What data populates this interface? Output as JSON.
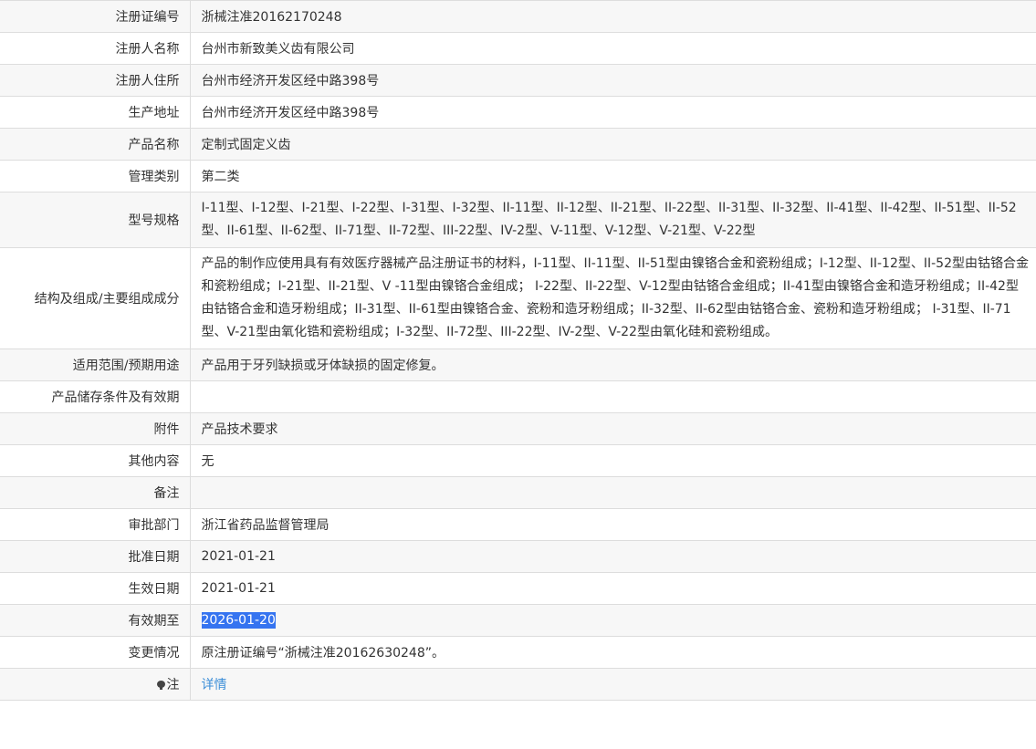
{
  "rows": [
    {
      "label": "注册证编号",
      "value": "浙械注准20162170248"
    },
    {
      "label": "注册人名称",
      "value": "台州市新致美义齿有限公司"
    },
    {
      "label": "注册人住所",
      "value": "台州市经济开发区经中路398号"
    },
    {
      "label": "生产地址",
      "value": "台州市经济开发区经中路398号"
    },
    {
      "label": "产品名称",
      "value": "定制式固定义齿"
    },
    {
      "label": "管理类别",
      "value": "第二类"
    },
    {
      "label": "型号规格",
      "value": "I-11型、I-12型、I-21型、I-22型、I-31型、I-32型、II-11型、II-12型、II-21型、II-22型、II-31型、II-32型、II-41型、II-42型、II-51型、II-52型、II-61型、II-62型、II-71型、II-72型、III-22型、IV-2型、V-11型、V-12型、V-21型、V-22型"
    },
    {
      "label": "结构及组成/主要组成成分",
      "value": "产品的制作应使用具有有效医疗器械产品注册证书的材料，I-11型、II-11型、II-51型由镍铬合金和瓷粉组成；I-12型、II-12型、II-52型由钴铬合金和瓷粉组成；I-21型、II-21型、V -11型由镍铬合金组成； I-22型、II-22型、V-12型由钴铬合金组成；II-41型由镍铬合金和造牙粉组成；II-42型由钴铬合金和造牙粉组成；II-31型、II-61型由镍铬合金、瓷粉和造牙粉组成；II-32型、II-62型由钴铬合金、瓷粉和造牙粉组成； I-31型、II-71型、V-21型由氧化锆和瓷粉组成；I-32型、II-72型、III-22型、IV-2型、V-22型由氧化硅和瓷粉组成。"
    },
    {
      "label": "适用范围/预期用途",
      "value": "产品用于牙列缺损或牙体缺损的固定修复。"
    },
    {
      "label": "产品储存条件及有效期",
      "value": ""
    },
    {
      "label": "附件",
      "value": "产品技术要求"
    },
    {
      "label": "其他内容",
      "value": "无"
    },
    {
      "label": "备注",
      "value": ""
    },
    {
      "label": "审批部门",
      "value": "浙江省药品监督管理局"
    },
    {
      "label": "批准日期",
      "value": "2021-01-21"
    },
    {
      "label": "生效日期",
      "value": "2021-01-21"
    },
    {
      "label": "有效期至",
      "value": "2026-01-20"
    },
    {
      "label": "变更情况",
      "value": "原注册证编号“浙械注准20162630248”。"
    }
  ],
  "note_row": {
    "label": "注",
    "icon": "lightbulb-icon",
    "link_text": "详情"
  },
  "colors": {
    "row_alt_bg": "#f7f7f7",
    "border": "#dddddd",
    "link": "#3d8fd8",
    "selection": "#3574f0"
  }
}
